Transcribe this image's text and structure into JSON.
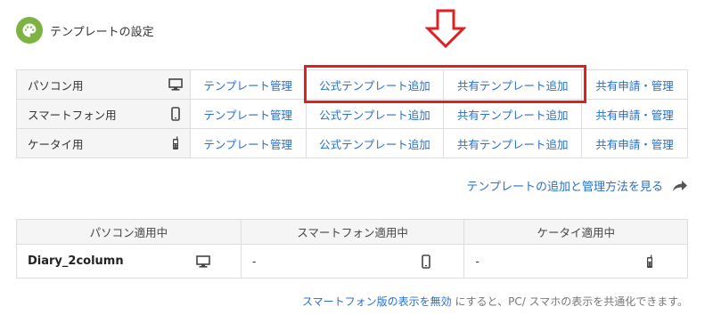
{
  "header": {
    "title": "テンプレートの設定",
    "icon": "palette-icon",
    "icon_color": "#7cb342"
  },
  "annotation": {
    "arrow_icon": "down-arrow-icon",
    "arrow_color": "#e02020",
    "highlight_color": "#e02020"
  },
  "templates": {
    "rows": [
      {
        "device": "パソコン用",
        "icon": "desktop-icon",
        "manage": "テンプレート管理",
        "add_official": "公式テンプレート追加",
        "add_shared": "共有テンプレート追加",
        "apply_manage": "共有申請・管理"
      },
      {
        "device": "スマートフォン用",
        "icon": "smartphone-icon",
        "manage": "テンプレート管理",
        "add_official": "公式テンプレート追加",
        "add_shared": "共有テンプレート追加",
        "apply_manage": "共有申請・管理"
      },
      {
        "device": "ケータイ用",
        "icon": "feature-phone-icon",
        "manage": "テンプレート管理",
        "add_official": "公式テンプレート追加",
        "add_shared": "共有テンプレート追加",
        "apply_manage": "共有申請・管理"
      }
    ]
  },
  "howto_link": "テンプレートの追加と管理方法を見る",
  "applied": {
    "headers": [
      "パソコン適用中",
      "スマートフォン適用中",
      "ケータイ適用中"
    ],
    "values": [
      "Diary_2column",
      "-",
      "-"
    ]
  },
  "footer": {
    "link": "スマートフォン版の表示を無効",
    "text": "にすると、PC/ スマホの表示を共通化できます。"
  },
  "colors": {
    "link": "#2a6fc9",
    "border": "#dddddd",
    "header_bg": "#f5f5f5"
  }
}
